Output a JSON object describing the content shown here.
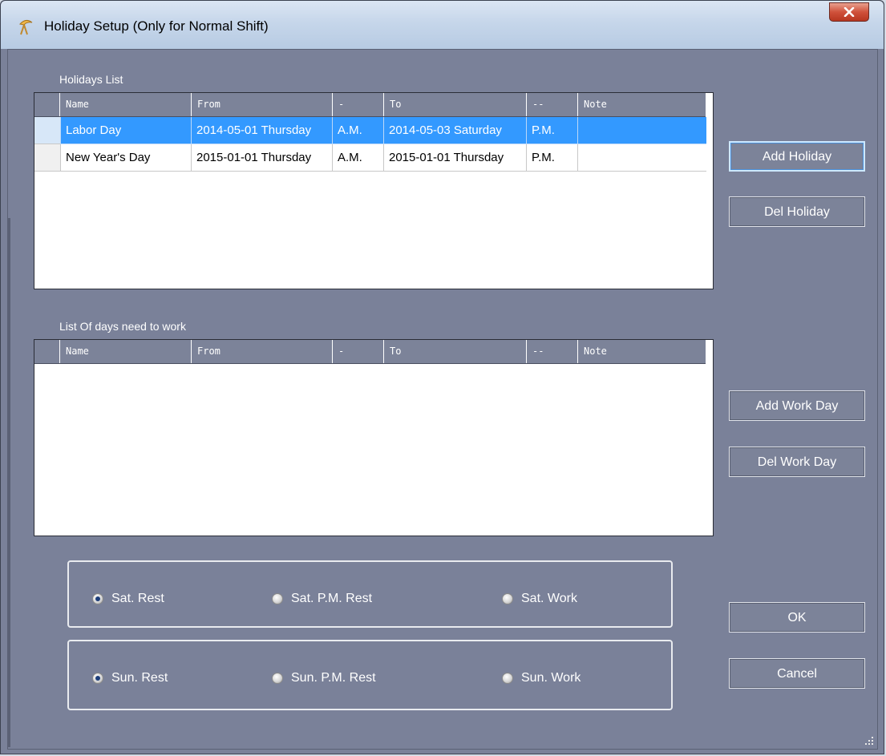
{
  "window": {
    "title": "Holiday Setup (Only for Normal Shift)",
    "close_icon": "close-icon",
    "app_icon": "holiday-icon"
  },
  "holidays": {
    "label": "Holidays List",
    "columns": [
      "Name",
      "From",
      "-",
      "To",
      "--",
      "Note"
    ],
    "rows": [
      {
        "name": "Labor Day",
        "from": "2014-05-01 Thursday",
        "from_half": "A.M.",
        "to": "2014-05-03 Saturday",
        "to_half": "P.M.",
        "note": "",
        "selected": true
      },
      {
        "name": "New Year's Day",
        "from": "2015-01-01 Thursday",
        "from_half": "A.M.",
        "to": "2015-01-01 Thursday",
        "to_half": "P.M.",
        "note": "",
        "selected": false
      }
    ]
  },
  "workdays": {
    "label": "List Of days need to work",
    "columns": [
      "Name",
      "From",
      "-",
      "To",
      "--",
      "Note"
    ],
    "rows": []
  },
  "buttons": {
    "add_holiday": "Add Holiday",
    "del_holiday": "Del Holiday",
    "add_work_day": "Add Work Day",
    "del_work_day": "Del Work Day",
    "ok": "OK",
    "cancel": "Cancel"
  },
  "saturday": {
    "options": [
      "Sat. Rest",
      "Sat.  P.M. Rest",
      "Sat. Work"
    ],
    "selected": "Sat. Rest"
  },
  "sunday": {
    "options": [
      "Sun. Rest",
      "Sun. P.M. Rest",
      "Sun. Work"
    ],
    "selected": "Sun. Rest"
  },
  "colors": {
    "background": "#7a8199",
    "selection": "#3399ff",
    "grid_header": "#7c8399"
  }
}
